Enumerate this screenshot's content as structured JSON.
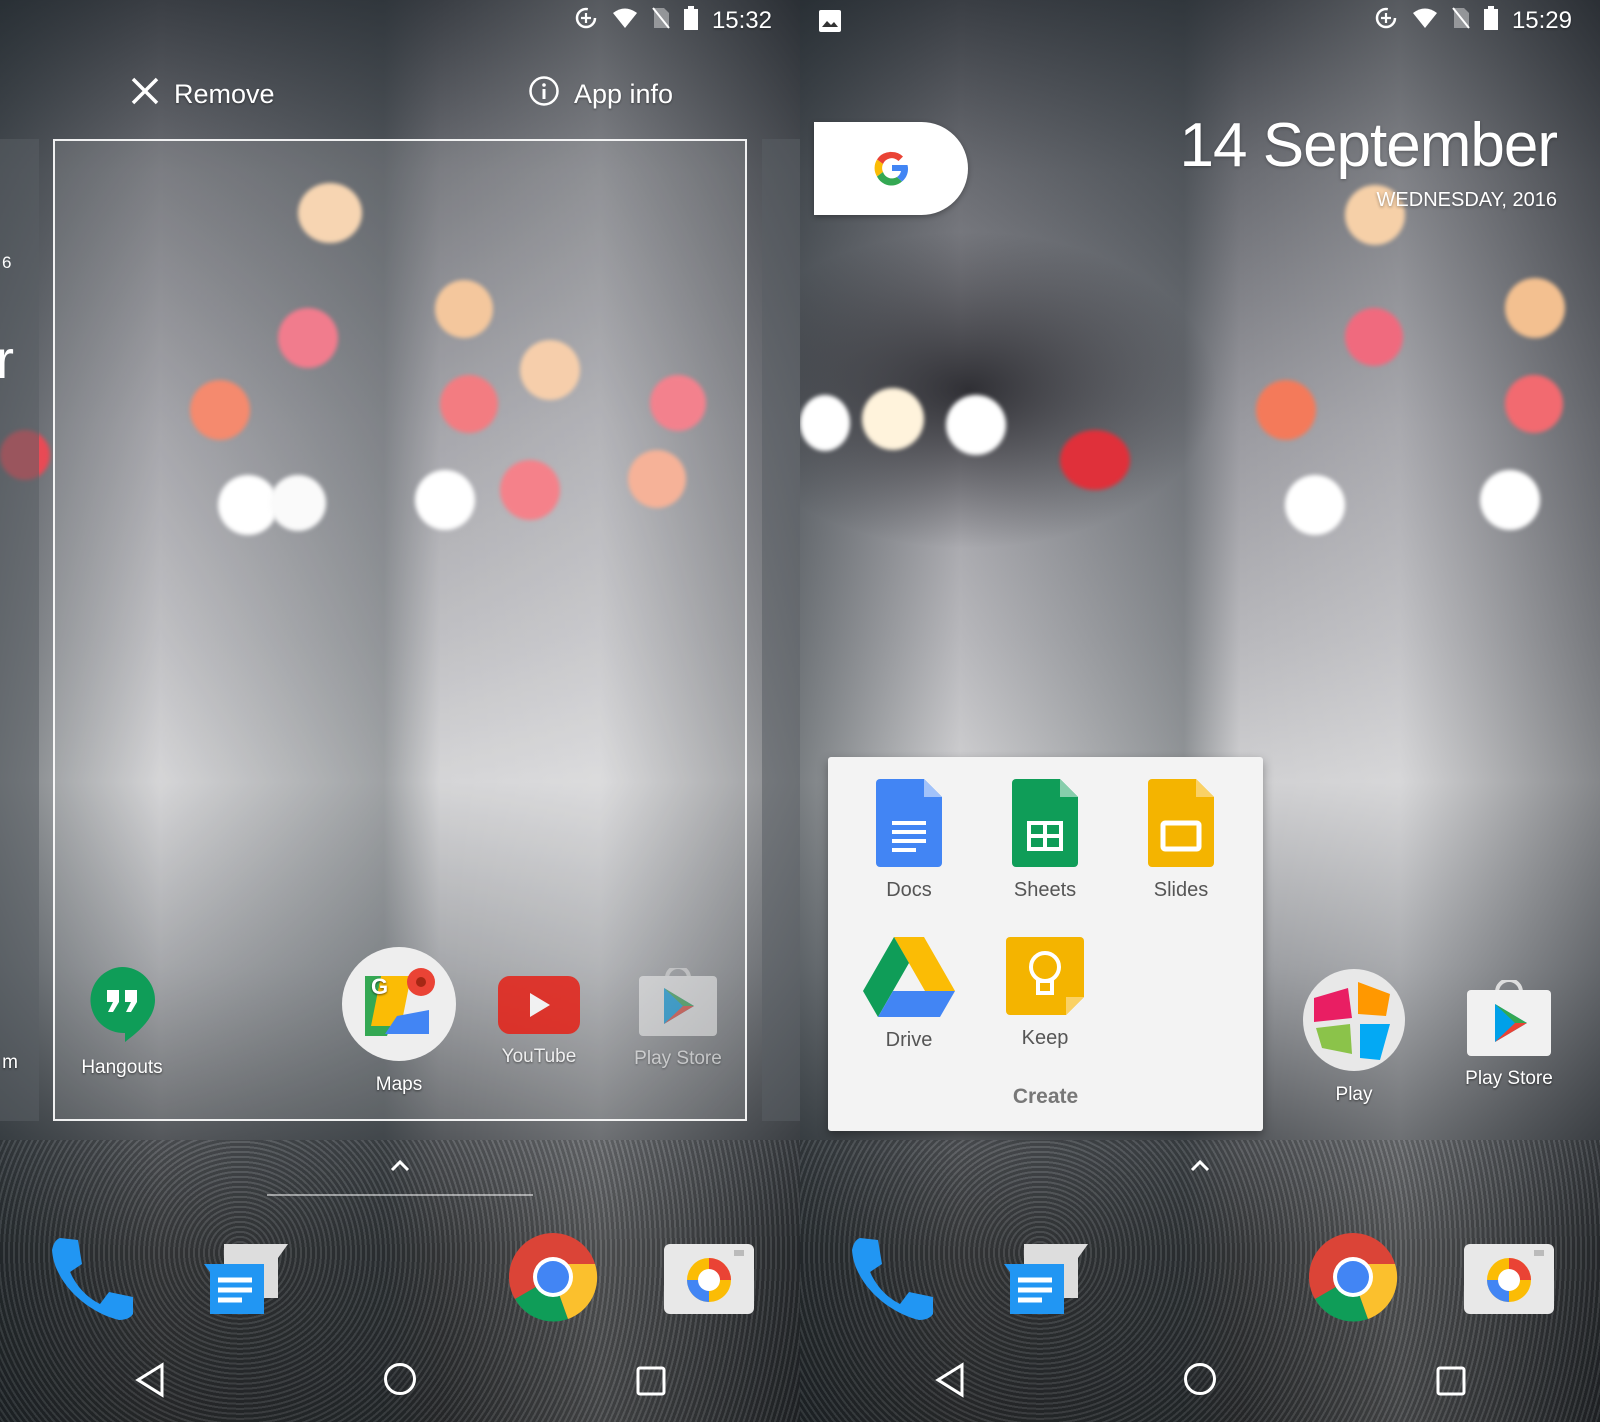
{
  "left_screen": {
    "status": {
      "time": "15:32",
      "icons": [
        "data-saver-icon",
        "wifi-icon",
        "no-sim-icon",
        "battery-icon"
      ]
    },
    "actions": {
      "remove_label": "Remove",
      "app_info_label": "App info"
    },
    "peek_fragment": {
      "big": "r",
      "small": "6"
    },
    "apps": [
      {
        "label": "m",
        "icon": "instagram-icon"
      },
      {
        "label": "Hangouts",
        "icon": "hangouts-icon"
      },
      {
        "label": "Maps",
        "icon": "maps-icon"
      },
      {
        "label": "YouTube",
        "icon": "youtube-icon"
      },
      {
        "label": "Play Store",
        "icon": "play-store-icon"
      }
    ],
    "dock": [
      "phone-icon",
      "messages-icon",
      "chrome-icon",
      "camera-icon"
    ]
  },
  "right_screen": {
    "status": {
      "time": "15:29",
      "icons": [
        "image-notification-icon",
        "data-saver-icon",
        "wifi-icon",
        "no-sim-icon",
        "battery-icon"
      ]
    },
    "date": {
      "day_month": "14 September",
      "weekday_year": "WEDNESDAY, 2016"
    },
    "folder": {
      "name": "Create",
      "apps": [
        {
          "label": "Docs"
        },
        {
          "label": "Sheets"
        },
        {
          "label": "Slides"
        },
        {
          "label": "Drive"
        },
        {
          "label": "Keep"
        }
      ]
    },
    "apps": [
      {
        "label": "Play"
      },
      {
        "label": "Play Store"
      }
    ],
    "dock": [
      "phone-icon",
      "messages-icon",
      "chrome-icon",
      "camera-icon"
    ]
  },
  "nav": [
    "back-icon",
    "home-icon",
    "recents-icon"
  ],
  "colors": {
    "folder_bg": "#f3f3f3",
    "google_blue": "#4285f4",
    "google_red": "#ea4335",
    "google_yellow": "#fbbc05",
    "google_green": "#34a853"
  }
}
